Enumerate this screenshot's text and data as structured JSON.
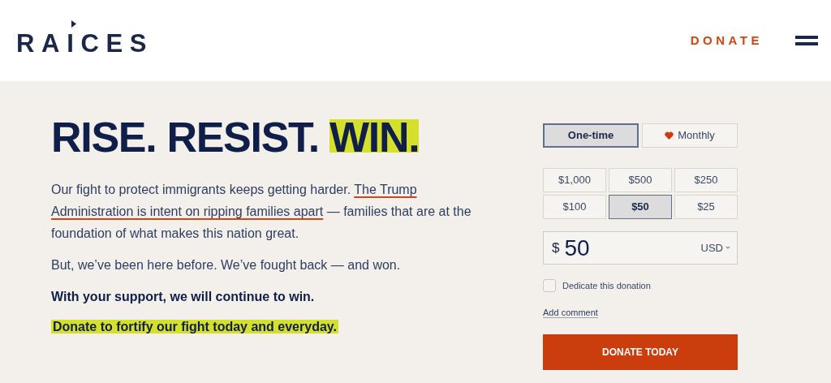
{
  "header": {
    "logo": "RAICES",
    "donate_link": "DONATE"
  },
  "headline": [
    {
      "text": "RISE. RESIST. ",
      "highlighted": false
    },
    {
      "text": "WIN.",
      "highlighted": true
    }
  ],
  "paragraphs": [
    {
      "kind": "text",
      "parts": [
        {
          "text": "Our fight to protect immigrants keeps getting harder. "
        },
        {
          "text": "The Trump Administration is intent on ripping families apart",
          "underlined": true
        },
        {
          "text": " — families that are at the foundation of what makes this nation great."
        }
      ]
    },
    {
      "kind": "text",
      "parts": [
        {
          "text": "But, we’ve been here before. We’ve fought back — and won."
        }
      ]
    },
    {
      "kind": "bold",
      "parts": [
        {
          "text": "With your support, we will continue to win."
        }
      ]
    },
    {
      "kind": "highlight",
      "parts": [
        {
          "text": "Donate to fortify our fight today and everyday."
        }
      ]
    }
  ],
  "form": {
    "frequency": [
      {
        "label": "One-time",
        "icon": false,
        "selected": true
      },
      {
        "label": "Monthly",
        "icon": true,
        "selected": false
      }
    ],
    "amounts": [
      {
        "label": "$1,000",
        "selected": false
      },
      {
        "label": "$500",
        "selected": false
      },
      {
        "label": "$250",
        "selected": false
      },
      {
        "label": "$100",
        "selected": false
      },
      {
        "label": "$50",
        "selected": true
      },
      {
        "label": "$25",
        "selected": false
      }
    ],
    "amount_field": {
      "symbol": "$",
      "value": "50",
      "currency": "USD"
    },
    "dedicate": {
      "label": "Dedicate this donation",
      "checked": false
    },
    "add_comment": "Add comment",
    "submit": "DONATE TODAY"
  }
}
